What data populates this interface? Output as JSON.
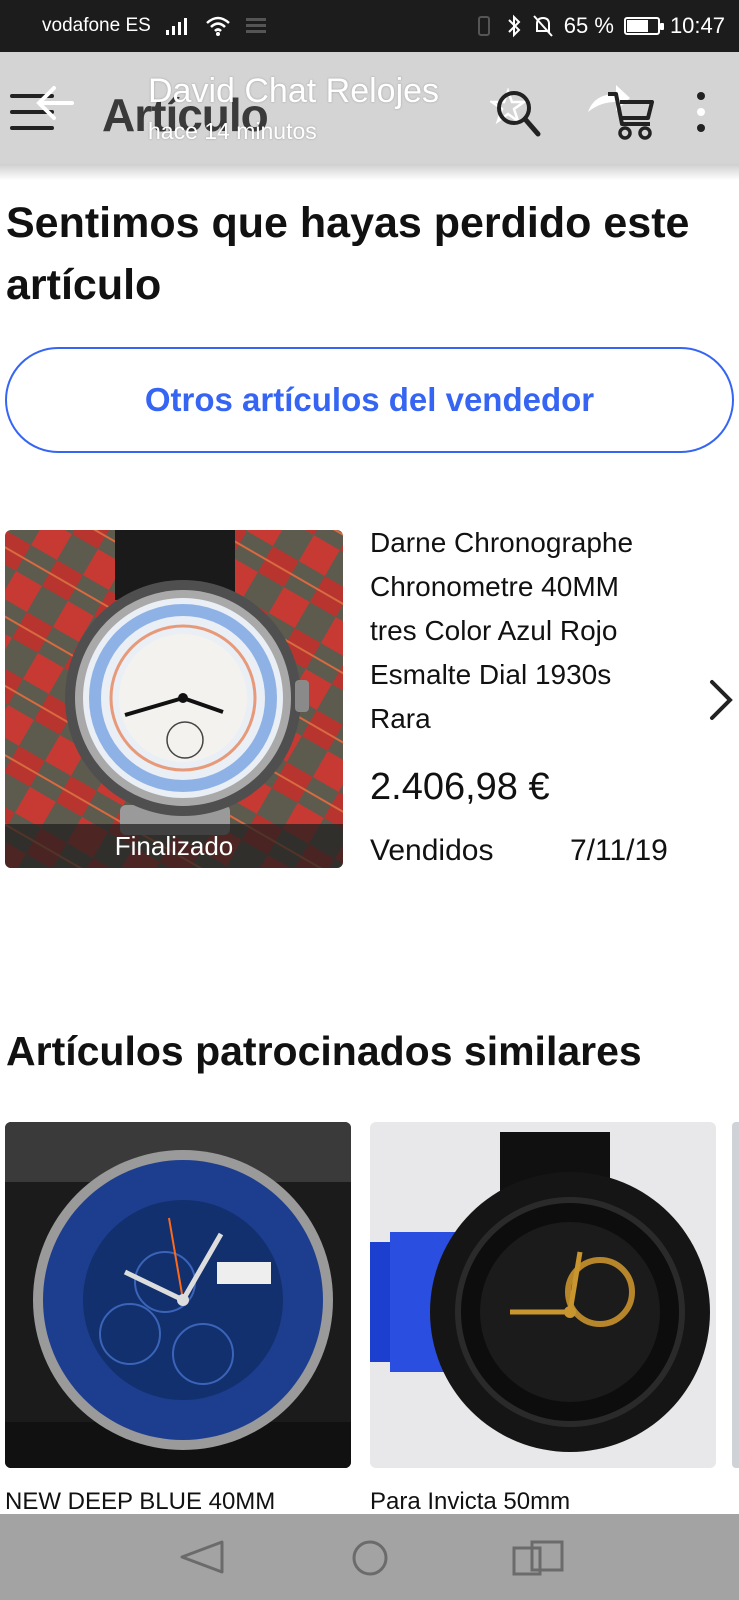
{
  "status_bar": {
    "carrier": "vodafone ES",
    "battery_percent": "65 %",
    "battery_level": 0.65,
    "time": "10:47"
  },
  "app_bar": {
    "title": "Artículo",
    "icons": [
      "menu-icon",
      "back-arrow-icon",
      "star-icon",
      "search-icon",
      "share-icon",
      "cart-icon",
      "more-vert-icon"
    ]
  },
  "chat_notification": {
    "name": "David Chat Relojes",
    "time": "hace 14 minutos"
  },
  "main": {
    "lost_heading": "Sentimos que hayas perdido este artículo",
    "other_items_button": "Otros artículos del vendedor",
    "product": {
      "title": "Darne Chronographe Chronometre 40MM tres Color Azul Rojo Esmalte Dial 1930s Rara",
      "price": "2.406,98 €",
      "ended_label": "Finalizado",
      "sold_label": "Vendidos",
      "sold_date": "7/11/19"
    },
    "similar_heading": "Artículos patrocinados similares",
    "similar_items": [
      {
        "title": "NEW DEEP BLUE 40MM"
      },
      {
        "title": "Para Invicta 50mm"
      }
    ]
  },
  "colors": {
    "accent": "#3665f3",
    "status_bar": "#1c1c1c",
    "app_bar": "#d4d4d4",
    "nav_bar": "#a3a3a3"
  }
}
